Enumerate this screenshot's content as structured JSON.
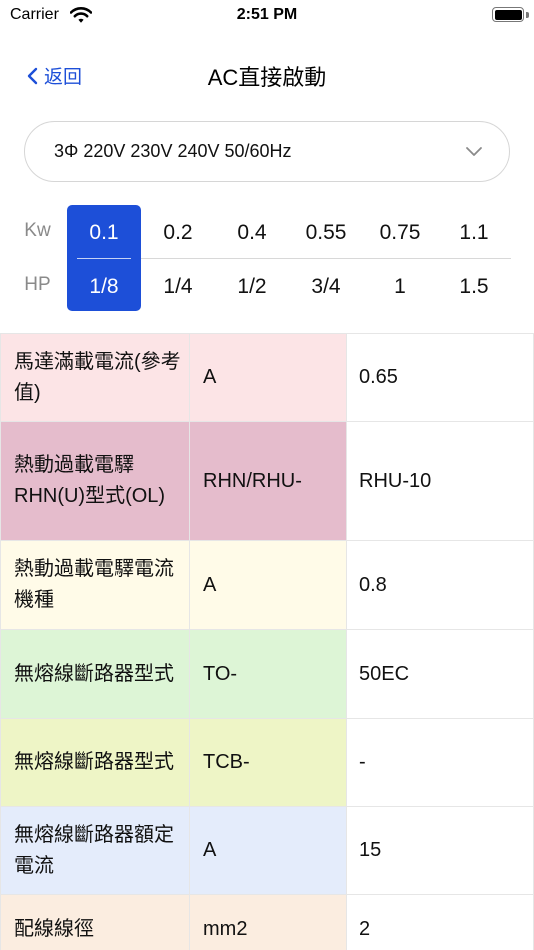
{
  "status_bar": {
    "carrier": "Carrier",
    "time": "2:51 PM"
  },
  "nav": {
    "back_label": "返回",
    "title": "AC直接啟動"
  },
  "voltage": {
    "selected": "3Φ 220V 230V 240V 50/60Hz"
  },
  "power": {
    "kw_label": "Kw",
    "hp_label": "HP",
    "options": [
      {
        "kw": "0.1",
        "hp": "1/8",
        "selected": true
      },
      {
        "kw": "0.2",
        "hp": "1/4",
        "selected": false
      },
      {
        "kw": "0.4",
        "hp": "1/2",
        "selected": false
      },
      {
        "kw": "0.55",
        "hp": "3/4",
        "selected": false
      },
      {
        "kw": "0.75",
        "hp": "1",
        "selected": false
      },
      {
        "kw": "1.1",
        "hp": "1.5",
        "selected": false
      }
    ]
  },
  "specs": [
    {
      "name": "馬達滿載電流(參考值)",
      "unit": "A",
      "value": "0.65",
      "color": "#fce4e6"
    },
    {
      "name": "熱動過載電驛RHN(U)型式(OL)",
      "unit": "RHN/RHU-",
      "value": "RHU-10",
      "color": "#e5bccc"
    },
    {
      "name": "熱動過載電驛電流機種",
      "unit": "A",
      "value": "0.8",
      "color": "#fffbe8"
    },
    {
      "name": "無熔線斷路器型式",
      "unit": "TO-",
      "value": "50EC",
      "color": "#ddf5d6"
    },
    {
      "name": "無熔線斷路器型式",
      "unit": "TCB-",
      "value": "-",
      "color": "#eef5c6"
    },
    {
      "name": "無熔線斷路器額定電流",
      "unit": "A",
      "value": "15",
      "color": "#e4ecfb"
    },
    {
      "name": "配線線徑",
      "unit": "mm2",
      "value": "2",
      "color": "#fbede0"
    }
  ],
  "colors": {
    "accent": "#1d4fd8"
  }
}
